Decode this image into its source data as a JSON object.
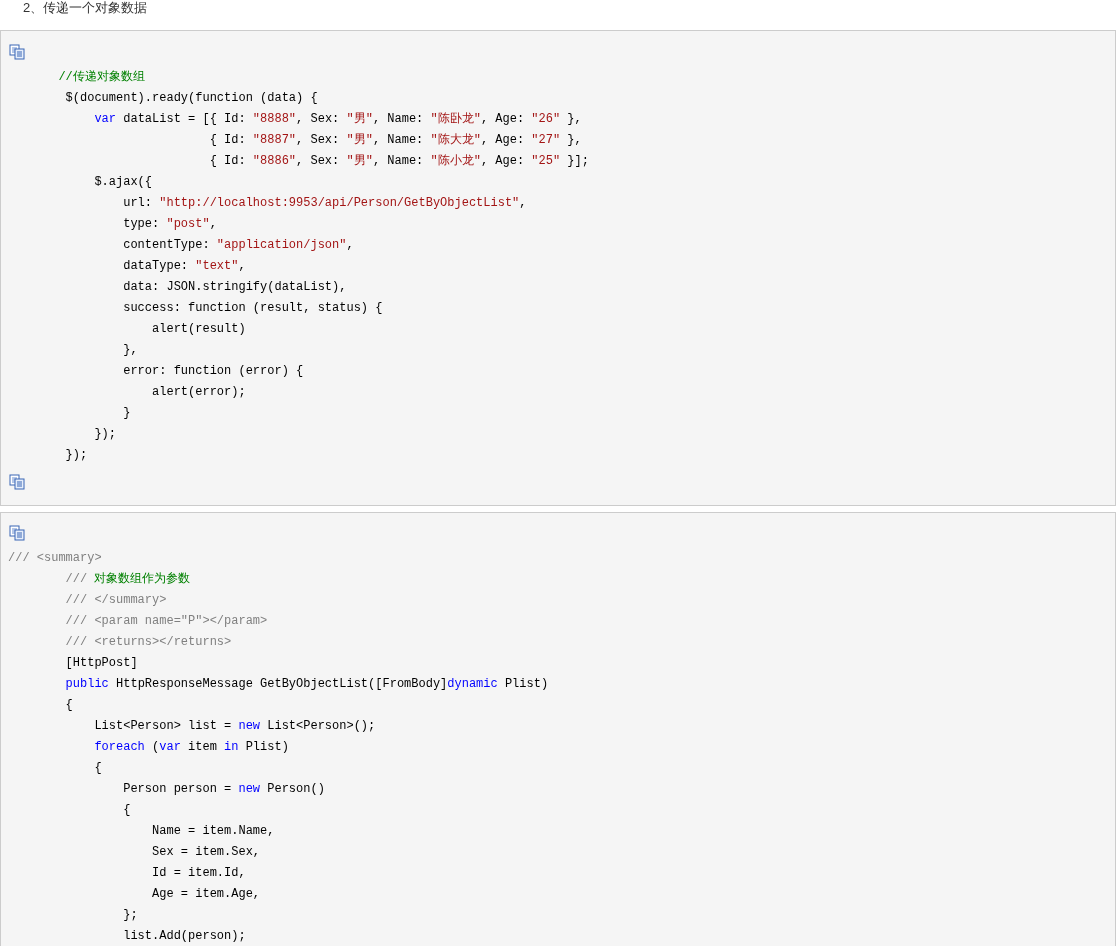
{
  "heading": "2、传递一个对象数据",
  "code_blocks": [
    {
      "lines": [
        [
          {
            "kind": "comment",
            "text": "       //传递对象数组"
          }
        ],
        [
          {
            "kind": "plain",
            "text": "        $(document).ready(function (data) {"
          }
        ],
        [
          {
            "kind": "keyword",
            "text": "            var"
          },
          {
            "kind": "plain",
            "text": " dataList = [{ Id: "
          },
          {
            "kind": "string",
            "text": "\"8888\""
          },
          {
            "kind": "plain",
            "text": ", Sex: "
          },
          {
            "kind": "string",
            "text": "\"男\""
          },
          {
            "kind": "plain",
            "text": ", Name: "
          },
          {
            "kind": "string",
            "text": "\"陈卧龙\""
          },
          {
            "kind": "plain",
            "text": ", Age: "
          },
          {
            "kind": "string",
            "text": "\"26\""
          },
          {
            "kind": "plain",
            "text": " },"
          }
        ],
        [
          {
            "kind": "plain",
            "text": "                            { Id: "
          },
          {
            "kind": "string",
            "text": "\"8887\""
          },
          {
            "kind": "plain",
            "text": ", Sex: "
          },
          {
            "kind": "string",
            "text": "\"男\""
          },
          {
            "kind": "plain",
            "text": ", Name: "
          },
          {
            "kind": "string",
            "text": "\"陈大龙\""
          },
          {
            "kind": "plain",
            "text": ", Age: "
          },
          {
            "kind": "string",
            "text": "\"27\""
          },
          {
            "kind": "plain",
            "text": " },"
          }
        ],
        [
          {
            "kind": "plain",
            "text": "                            { Id: "
          },
          {
            "kind": "string",
            "text": "\"8886\""
          },
          {
            "kind": "plain",
            "text": ", Sex: "
          },
          {
            "kind": "string",
            "text": "\"男\""
          },
          {
            "kind": "plain",
            "text": ", Name: "
          },
          {
            "kind": "string",
            "text": "\"陈小龙\""
          },
          {
            "kind": "plain",
            "text": ", Age: "
          },
          {
            "kind": "string",
            "text": "\"25\""
          },
          {
            "kind": "plain",
            "text": " }];"
          }
        ],
        [
          {
            "kind": "plain",
            "text": "            $.ajax({"
          }
        ],
        [
          {
            "kind": "plain",
            "text": "                url: "
          },
          {
            "kind": "string",
            "text": "\"http://localhost:9953/api/Person/GetByObjectList\""
          },
          {
            "kind": "plain",
            "text": ","
          }
        ],
        [
          {
            "kind": "plain",
            "text": "                type: "
          },
          {
            "kind": "string",
            "text": "\"post\""
          },
          {
            "kind": "plain",
            "text": ","
          }
        ],
        [
          {
            "kind": "plain",
            "text": "                contentType: "
          },
          {
            "kind": "string",
            "text": "\"application/json\""
          },
          {
            "kind": "plain",
            "text": ","
          }
        ],
        [
          {
            "kind": "plain",
            "text": "                dataType: "
          },
          {
            "kind": "string",
            "text": "\"text\""
          },
          {
            "kind": "plain",
            "text": ","
          }
        ],
        [
          {
            "kind": "plain",
            "text": "                data: JSON.stringify(dataList),"
          }
        ],
        [
          {
            "kind": "plain",
            "text": "                success: function (result, status) {"
          }
        ],
        [
          {
            "kind": "plain",
            "text": "                    alert(result)"
          }
        ],
        [
          {
            "kind": "plain",
            "text": "                },"
          }
        ],
        [
          {
            "kind": "plain",
            "text": "                error: function (error) {"
          }
        ],
        [
          {
            "kind": "plain",
            "text": "                    alert(error);"
          }
        ],
        [
          {
            "kind": "plain",
            "text": "                }"
          }
        ],
        [
          {
            "kind": "plain",
            "text": "            });"
          }
        ],
        [
          {
            "kind": "plain",
            "text": "        });"
          }
        ]
      ]
    },
    {
      "lines": [
        [
          {
            "kind": "doc",
            "text": "/// <summary>"
          }
        ],
        [
          {
            "kind": "doc",
            "text": "        /// "
          },
          {
            "kind": "comment",
            "text": "对象数组作为参数"
          }
        ],
        [
          {
            "kind": "doc",
            "text": "        /// </summary>"
          }
        ],
        [
          {
            "kind": "doc",
            "text": "        /// <param name=\"P\"></param>"
          }
        ],
        [
          {
            "kind": "doc",
            "text": "        /// <returns></returns>"
          }
        ],
        [
          {
            "kind": "plain",
            "text": "        [HttpPost]"
          }
        ],
        [
          {
            "kind": "keyword",
            "text": "        public"
          },
          {
            "kind": "plain",
            "text": " HttpResponseMessage GetByObjectList([FromBody]"
          },
          {
            "kind": "keyword",
            "text": "dynamic"
          },
          {
            "kind": "plain",
            "text": " Plist)"
          }
        ],
        [
          {
            "kind": "plain",
            "text": "        {"
          }
        ],
        [
          {
            "kind": "plain",
            "text": "            List<Person> list = "
          },
          {
            "kind": "keyword",
            "text": "new"
          },
          {
            "kind": "plain",
            "text": " List<Person>();"
          }
        ],
        [
          {
            "kind": "keyword",
            "text": "            foreach"
          },
          {
            "kind": "plain",
            "text": " ("
          },
          {
            "kind": "keyword",
            "text": "var"
          },
          {
            "kind": "plain",
            "text": " item "
          },
          {
            "kind": "keyword",
            "text": "in"
          },
          {
            "kind": "plain",
            "text": " Plist)"
          }
        ],
        [
          {
            "kind": "plain",
            "text": "            {"
          }
        ],
        [
          {
            "kind": "plain",
            "text": "                Person person = "
          },
          {
            "kind": "keyword",
            "text": "new"
          },
          {
            "kind": "plain",
            "text": " Person()"
          }
        ],
        [
          {
            "kind": "plain",
            "text": "                {"
          }
        ],
        [
          {
            "kind": "plain",
            "text": "                    Name = item.Name,"
          }
        ],
        [
          {
            "kind": "plain",
            "text": "                    Sex = item.Sex,"
          }
        ],
        [
          {
            "kind": "plain",
            "text": "                    Id = item.Id,"
          }
        ],
        [
          {
            "kind": "plain",
            "text": "                    Age = item.Age,"
          }
        ],
        [
          {
            "kind": "plain",
            "text": "                };"
          }
        ],
        [
          {
            "kind": "plain",
            "text": "                list.Add(person);"
          }
        ]
      ]
    }
  ]
}
